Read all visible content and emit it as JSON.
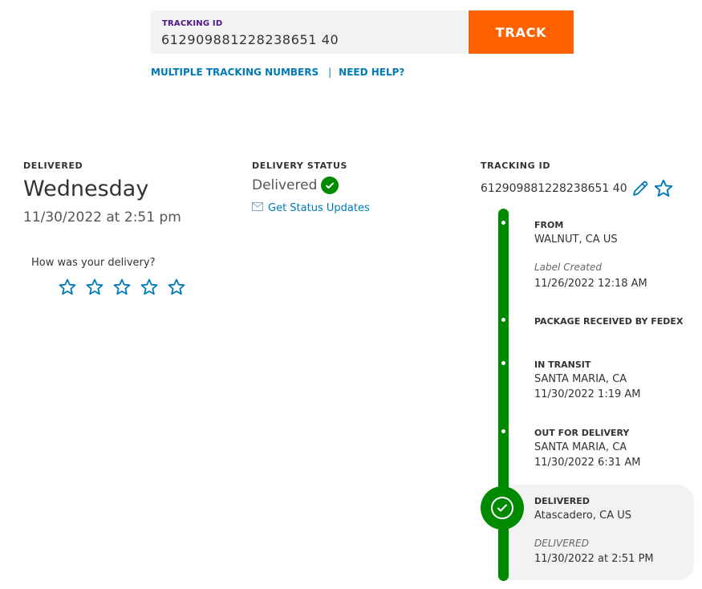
{
  "search": {
    "label": "TRACKING ID",
    "value": "612909881228238651 40",
    "button": "TRACK"
  },
  "links": {
    "multiple": "MULTIPLE TRACKING NUMBERS",
    "separator": "|",
    "help": "NEED HELP?"
  },
  "delivered_col": {
    "heading": "DELIVERED",
    "day": "Wednesday",
    "datetime": "11/30/2022 at 2:51 pm",
    "rating_prompt": "How was your delivery?",
    "rating_stars": 5
  },
  "status_col": {
    "heading": "DELIVERY STATUS",
    "value": "Delivered",
    "updates_link": "Get Status Updates"
  },
  "tracking_col": {
    "heading": "TRACKING ID",
    "value": "612909881228238651 40"
  },
  "timeline": {
    "from": {
      "title": "FROM",
      "location": "WALNUT, CA US",
      "note": "Label Created",
      "time": "11/26/2022 12:18 AM"
    },
    "received": {
      "title": "PACKAGE RECEIVED BY FEDEX"
    },
    "transit": {
      "title": "IN TRANSIT",
      "location": "SANTA MARIA, CA",
      "time": "11/30/2022 1:19 AM"
    },
    "out": {
      "title": "OUT FOR DELIVERY",
      "location": "SANTA MARIA, CA",
      "time": "11/30/2022 6:31 AM"
    },
    "delivered": {
      "title": "DELIVERED",
      "location": "Atascadero, CA US",
      "note": "DELIVERED",
      "time": "11/30/2022 at 2:51 PM"
    }
  },
  "colors": {
    "brand_purple": "#4d148c",
    "track_orange": "#ff6200",
    "link_blue": "#007ab7",
    "success_green": "#008a00"
  }
}
